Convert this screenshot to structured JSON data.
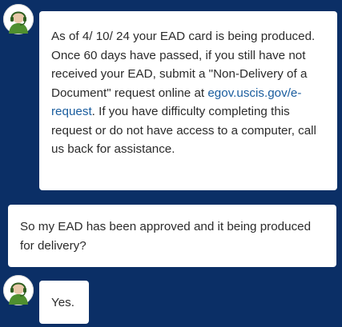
{
  "messages": [
    {
      "sender": "agent",
      "text_before_link": "As of 4/ 10/ 24 your EAD card is being produced.  Once 60 days have passed, if you still have not received your EAD, submit a \"Non-Delivery of a Document\" request online at ",
      "link_text": "egov.uscis.gov/e-request",
      "text_after_link": ". If you have difficulty completing this request or do not have access to a computer, call us back for assistance."
    },
    {
      "sender": "user",
      "text": "So my EAD has been approved and it being produced for delivery?"
    },
    {
      "sender": "agent",
      "text": "Yes."
    }
  ],
  "colors": {
    "background": "#0b2f66",
    "bubble": "#ffffff",
    "text": "#2b2b2b",
    "link": "#1a5d9e",
    "avatar_accent": "#4f8f2f"
  },
  "icons": {
    "agent_avatar": "headset-agent-icon"
  }
}
